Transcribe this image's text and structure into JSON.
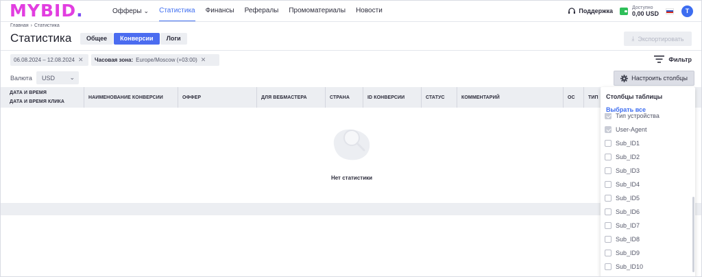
{
  "header": {
    "logo": "MYBID",
    "logo_dot": ".",
    "nav": [
      {
        "label": "Офферы",
        "has_chevron": true,
        "active": false
      },
      {
        "label": "Статистика",
        "active": true
      },
      {
        "label": "Финансы",
        "active": false
      },
      {
        "label": "Рефералы",
        "active": false
      },
      {
        "label": "Промоматериалы",
        "active": false
      },
      {
        "label": "Новости",
        "active": false
      }
    ],
    "support_label": "Поддержка",
    "balance_label": "Доступно",
    "balance_value": "0,00 USD",
    "avatar_letter": "T"
  },
  "breadcrumb": {
    "home": "Главная",
    "current": "Статистика"
  },
  "page": {
    "title": "Статистика",
    "tabs": [
      "Общее",
      "Конверсии",
      "Логи"
    ],
    "active_tab": "Конверсии",
    "export_label": "Экспортировать"
  },
  "filters": {
    "date_range": "06.08.2024 – 12.08.2024",
    "timezone_label": "Часовая зона:",
    "timezone_value": "Europe/Moscow (+03:00)",
    "filter_label": "Фильтр",
    "currency_label": "Валюта",
    "currency_value": "USD",
    "configure_columns_label": "Настроить столбцы"
  },
  "table": {
    "headers": [
      {
        "line1": "ДАТА И ВРЕМЯ",
        "line2": "ДАТА И ВРЕМЯ КЛИКА"
      },
      {
        "line1": "НАИМЕНОВАНИЕ КОНВЕРСИИ"
      },
      {
        "line1": "ОФФЕР"
      },
      {
        "line1": "ДЛЯ ВЕБМАСТЕРА"
      },
      {
        "line1": "СТРАНА"
      },
      {
        "line1": "ID КОНВЕРСИИ"
      },
      {
        "line1": "СТАТУС"
      },
      {
        "line1": "КОММЕНТАРИЙ"
      },
      {
        "line1": "ОС"
      },
      {
        "line1": "ТИП"
      }
    ],
    "empty_text": "Нет статистики"
  },
  "columns_dropdown": {
    "title": "Столбцы таблицы",
    "select_all": "Выбрать все",
    "items": [
      {
        "label": "Тип устройства",
        "checked": true
      },
      {
        "label": "User-Agent",
        "checked": true
      },
      {
        "label": "Sub_ID1",
        "checked": false
      },
      {
        "label": "Sub_ID2",
        "checked": false
      },
      {
        "label": "Sub_ID3",
        "checked": false
      },
      {
        "label": "Sub_ID4",
        "checked": false
      },
      {
        "label": "Sub_ID5",
        "checked": false
      },
      {
        "label": "Sub_ID6",
        "checked": false
      },
      {
        "label": "Sub_ID7",
        "checked": false
      },
      {
        "label": "Sub_ID8",
        "checked": false
      },
      {
        "label": "Sub_ID9",
        "checked": false
      },
      {
        "label": "Sub_ID10",
        "checked": false
      }
    ]
  },
  "colors": {
    "accent": "#3d6df0",
    "logo": "#e23ee0",
    "logo_dot": "#7a4df2",
    "wallet": "#2fbf5a",
    "surface": "#eceef2"
  }
}
